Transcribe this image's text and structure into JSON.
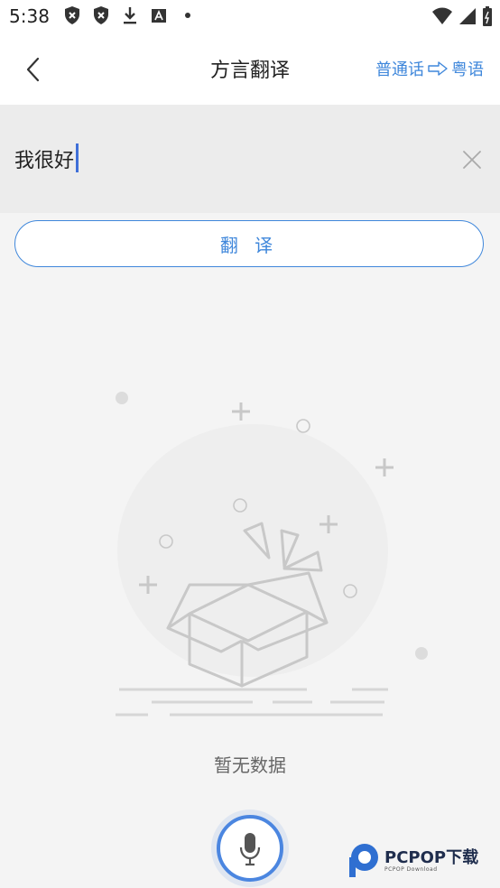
{
  "status_bar": {
    "time": "5:38",
    "icons": [
      "shield-icon",
      "shield-x-icon",
      "download-icon",
      "font-icon",
      "dot-icon"
    ],
    "right_icons": [
      "wifi-icon",
      "signal-icon",
      "battery-icon"
    ]
  },
  "header": {
    "title": "方言翻译",
    "source_lang": "普通话",
    "target_lang": "粤语"
  },
  "input": {
    "value": "我很好"
  },
  "translate_button": {
    "label": "翻 译"
  },
  "empty_state": {
    "text": "暂无数据"
  },
  "colors": {
    "accent": "#3f87db",
    "mic_ring": "#4b86e0",
    "input_bg": "#ececec",
    "page_bg": "#f4f4f4"
  },
  "watermark": {
    "name": "PCPOP下载",
    "sub": "PCPOP Download"
  }
}
